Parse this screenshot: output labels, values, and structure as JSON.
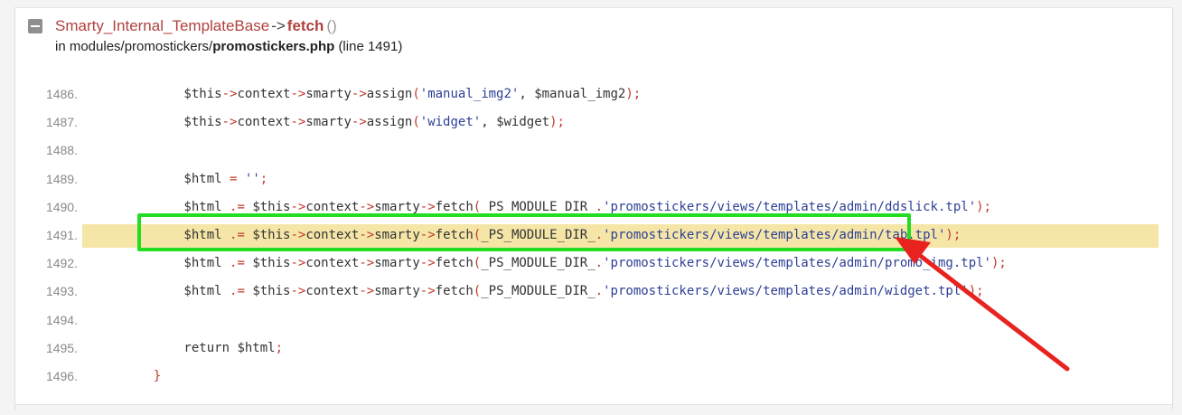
{
  "frame": {
    "class_name": "Smarty_Internal_TemplateBase",
    "arrow_op": "->",
    "function_name": "fetch",
    "parens": "()",
    "file_prefix": "in modules/promostickers/",
    "file_name": "promostickers.php",
    "line_info": "(line 1491)"
  },
  "code_lines": [
    {
      "num": "1486.",
      "highlighted": false,
      "tokens": [
        [
          "v",
          "        $this"
        ],
        [
          "o",
          "->"
        ],
        [
          "k",
          "context"
        ],
        [
          "o",
          "->"
        ],
        [
          "k",
          "smarty"
        ],
        [
          "o",
          "->"
        ],
        [
          "k",
          "assign"
        ],
        [
          "o",
          "("
        ],
        [
          "s",
          "'manual_img2'"
        ],
        [
          "k",
          ", "
        ],
        [
          "v",
          "$manual_img2"
        ],
        [
          "o",
          ");"
        ]
      ]
    },
    {
      "num": "1487.",
      "highlighted": false,
      "tokens": [
        [
          "v",
          "        $this"
        ],
        [
          "o",
          "->"
        ],
        [
          "k",
          "context"
        ],
        [
          "o",
          "->"
        ],
        [
          "k",
          "smarty"
        ],
        [
          "o",
          "->"
        ],
        [
          "k",
          "assign"
        ],
        [
          "o",
          "("
        ],
        [
          "s",
          "'widget'"
        ],
        [
          "k",
          ", "
        ],
        [
          "v",
          "$widget"
        ],
        [
          "o",
          ");"
        ]
      ]
    },
    {
      "num": "1488.",
      "highlighted": false,
      "tokens": []
    },
    {
      "num": "1489.",
      "highlighted": false,
      "tokens": [
        [
          "v",
          "        $html "
        ],
        [
          "o",
          "="
        ],
        [
          "k",
          " "
        ],
        [
          "s",
          "''"
        ],
        [
          "o",
          ";"
        ]
      ]
    },
    {
      "num": "1490.",
      "highlighted": false,
      "tokens": [
        [
          "v",
          "        $html "
        ],
        [
          "o",
          ".="
        ],
        [
          "k",
          " "
        ],
        [
          "v",
          "$this"
        ],
        [
          "o",
          "->"
        ],
        [
          "k",
          "context"
        ],
        [
          "o",
          "->"
        ],
        [
          "k",
          "smarty"
        ],
        [
          "o",
          "->"
        ],
        [
          "k",
          "fetch"
        ],
        [
          "o",
          "("
        ],
        [
          "k",
          "_PS_MODULE_DIR_"
        ],
        [
          "o",
          "."
        ],
        [
          "s",
          "'promostickers/views/templates/admin/ddslick.tpl'"
        ],
        [
          "o",
          ");"
        ]
      ]
    },
    {
      "num": "1491.",
      "highlighted": true,
      "tokens": [
        [
          "v",
          "        $html "
        ],
        [
          "o",
          ".="
        ],
        [
          "k",
          " "
        ],
        [
          "v",
          "$this"
        ],
        [
          "o",
          "->"
        ],
        [
          "k",
          "context"
        ],
        [
          "o",
          "->"
        ],
        [
          "k",
          "smarty"
        ],
        [
          "o",
          "->"
        ],
        [
          "k",
          "fetch"
        ],
        [
          "o",
          "("
        ],
        [
          "k",
          "_PS_MODULE_DIR_"
        ],
        [
          "o",
          "."
        ],
        [
          "s",
          "'promostickers/views/templates/admin/tab.tpl'"
        ],
        [
          "o",
          ");"
        ]
      ]
    },
    {
      "num": "1492.",
      "highlighted": false,
      "tokens": [
        [
          "v",
          "        $html "
        ],
        [
          "o",
          ".="
        ],
        [
          "k",
          " "
        ],
        [
          "v",
          "$this"
        ],
        [
          "o",
          "->"
        ],
        [
          "k",
          "context"
        ],
        [
          "o",
          "->"
        ],
        [
          "k",
          "smarty"
        ],
        [
          "o",
          "->"
        ],
        [
          "k",
          "fetch"
        ],
        [
          "o",
          "("
        ],
        [
          "k",
          "_PS_MODULE_DIR_"
        ],
        [
          "o",
          "."
        ],
        [
          "s",
          "'promostickers/views/templates/admin/promo_img.tpl'"
        ],
        [
          "o",
          ");"
        ]
      ]
    },
    {
      "num": "1493.",
      "highlighted": false,
      "tokens": [
        [
          "v",
          "        $html "
        ],
        [
          "o",
          ".="
        ],
        [
          "k",
          " "
        ],
        [
          "v",
          "$this"
        ],
        [
          "o",
          "->"
        ],
        [
          "k",
          "context"
        ],
        [
          "o",
          "->"
        ],
        [
          "k",
          "smarty"
        ],
        [
          "o",
          "->"
        ],
        [
          "k",
          "fetch"
        ],
        [
          "o",
          "("
        ],
        [
          "k",
          "_PS_MODULE_DIR_"
        ],
        [
          "o",
          "."
        ],
        [
          "s",
          "'promostickers/views/templates/admin/widget.tpl'"
        ],
        [
          "o",
          ");"
        ]
      ]
    },
    {
      "num": "1494.",
      "highlighted": false,
      "tokens": []
    },
    {
      "num": "1495.",
      "highlighted": false,
      "tokens": [
        [
          "k",
          "        return "
        ],
        [
          "v",
          "$html"
        ],
        [
          "o",
          ";"
        ]
      ]
    },
    {
      "num": "1496.",
      "highlighted": false,
      "tokens": [
        [
          "o",
          "    }"
        ]
      ]
    }
  ],
  "annotations": {
    "box_color": "#22dd22",
    "arrow_color": "#e8231f"
  },
  "icons": {
    "collapse": "minus-square-icon"
  }
}
